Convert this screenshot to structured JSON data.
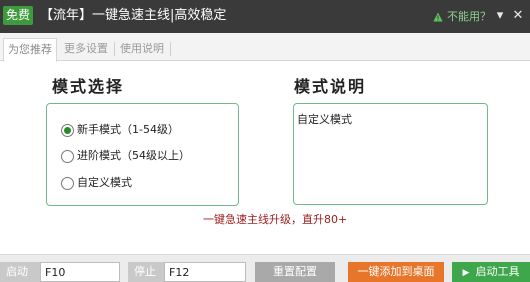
{
  "titlebar": {
    "badge": "免费",
    "title": "【流年】一键急速主线|高效稳定",
    "help_link": "不能用？",
    "menu_glyph": "▾",
    "close_glyph": "✕",
    "accent_color": "#3d9b3d"
  },
  "tabs": [
    {
      "label": "为您推荐",
      "active": true
    },
    {
      "label": "更多设置",
      "active": false
    },
    {
      "label": "使用说明",
      "active": false
    }
  ],
  "mode_select": {
    "title": "模式选择",
    "options": [
      {
        "label": "新手模式（1-54级）",
        "checked": true
      },
      {
        "label": "进阶模式（54级以上）",
        "checked": false
      },
      {
        "label": "自定义模式",
        "checked": false
      }
    ]
  },
  "mode_desc": {
    "title": "模式说明",
    "text": "自定义模式"
  },
  "promo_text": "一键急速主线升级，直升80+",
  "bottom": {
    "start_label": "启动",
    "start_key": "F10",
    "stop_label": "停止",
    "stop_key": "F12",
    "reset_button": "重置配置",
    "add_desktop_button": "一键添加到桌面",
    "launch_button": "启动工具"
  }
}
